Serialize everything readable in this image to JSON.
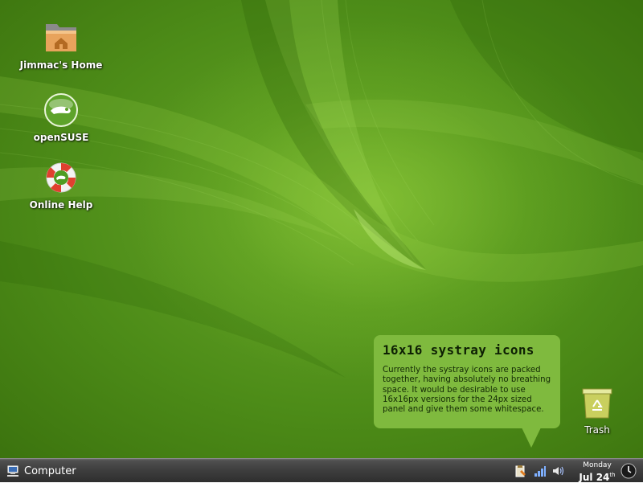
{
  "desktop": {
    "icons": [
      {
        "label": "Jimmac's Home",
        "icon": "home-folder-icon"
      },
      {
        "label": "openSUSE",
        "icon": "opensuse-gecko-icon"
      },
      {
        "label": "Online Help",
        "icon": "lifebuoy-icon"
      }
    ],
    "trash": {
      "label": "Trash",
      "icon": "trash-icon"
    }
  },
  "notification": {
    "title": "16x16 systray icons",
    "body": "Currently the systray icons are packed together, having absolutely no breathing space. It would be desirable to use 16x16px versions for the 24px sized panel and give them some whitespace."
  },
  "panel": {
    "menu_label": "Computer",
    "menu_icon": "computer-icon",
    "tray": [
      {
        "icon": "clipboard-icon"
      },
      {
        "icon": "network-signal-icon"
      },
      {
        "icon": "volume-icon"
      }
    ],
    "clock": {
      "day": "Monday",
      "date": "Jul 24",
      "suffix": "th",
      "icon": "clock-icon"
    }
  },
  "colors": {
    "desktop_green": "#4d8c18",
    "bubble_green": "#7fba3e",
    "panel_dark": "#3d3d3d"
  }
}
